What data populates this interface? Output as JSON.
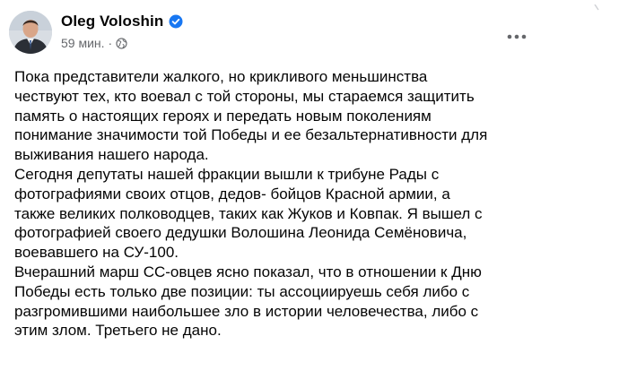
{
  "post": {
    "author": {
      "name": "Oleg Voloshin",
      "verified": true
    },
    "time": "59 мин.",
    "audience_icon": "globe-icon",
    "more_icon": "more-horizontal-icon",
    "paragraphs": [
      {
        "lines": [
          "Пока представители жалкого, но крикливого меньшинства",
          "чествуют тех, кто воевал с той стороны, мы стараемся защитить",
          "память о настоящих героях и передать новым поколениям",
          "понимание значимости той Победы и ее безальтернативности для",
          "выживания нашего народа."
        ]
      },
      {
        "lines": [
          "Сегодня депутаты нашей фракции вышли к трибуне Рады с",
          "фотографиями своих отцов, дедов- бойцов Красной армии, а",
          "также великих полководцев, таких как Жуков и Ковпак. Я вышел с",
          "фотографией своего дедушки Волошина Леонида Семёновича,",
          "воевавшего на СУ-100."
        ]
      },
      {
        "lines": [
          "Вчерашний марш СС-овцев ясно показал, что в отношении к Дню",
          "Победы есть только две позиции: ты ассоциируешь себя либо с",
          "разгромившими наибольшее зло в истории человечества, либо с",
          "этим злом. Третьего не дано."
        ]
      }
    ]
  },
  "colors": {
    "text": "#050505",
    "secondary_text": "#65676b",
    "verified_badge": "#1877f2",
    "background": "#ffffff"
  }
}
